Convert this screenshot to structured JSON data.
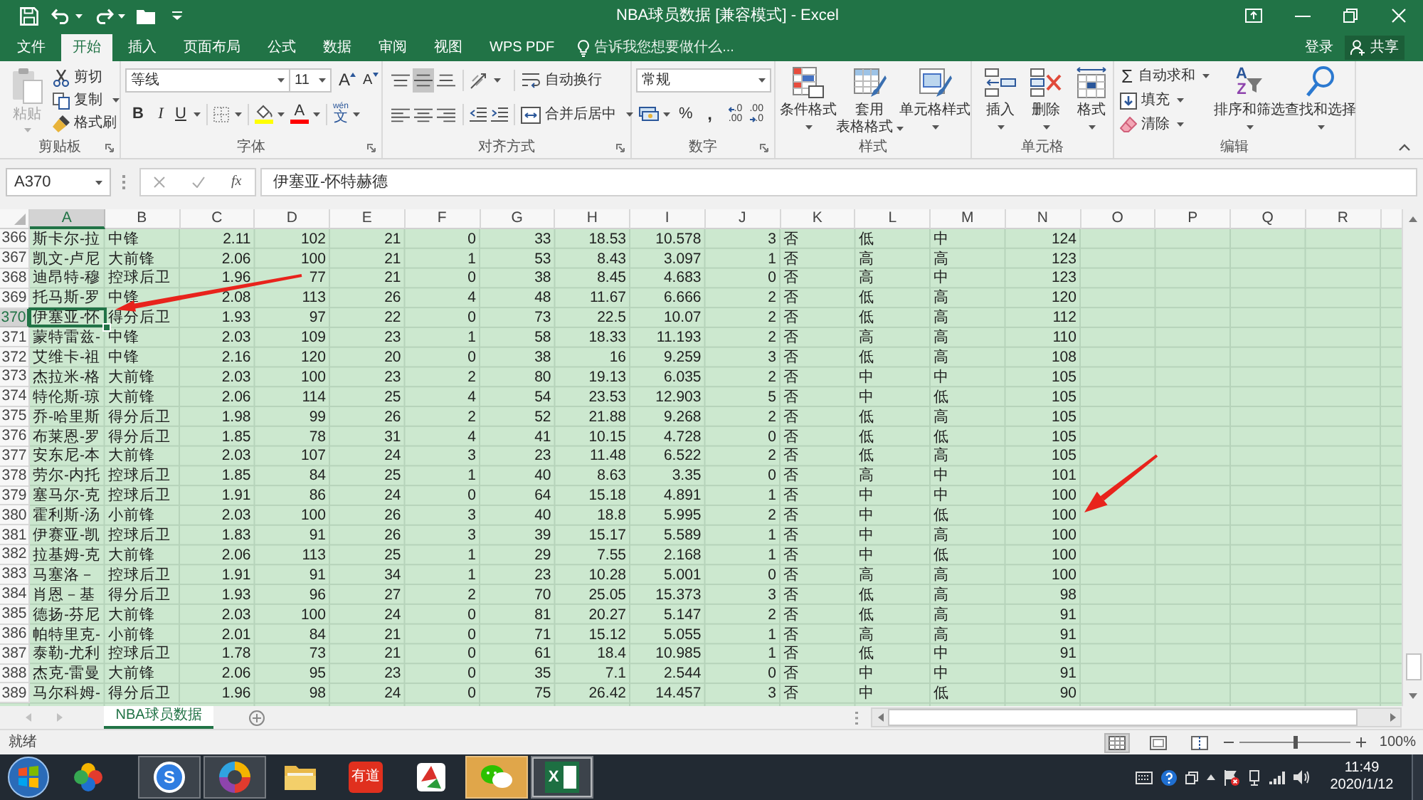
{
  "title_bar": {
    "title": "NBA球员数据 [兼容模式] - Excel"
  },
  "ribbon_tabs": [
    {
      "label": "文件",
      "selected": false
    },
    {
      "label": "开始",
      "selected": true
    },
    {
      "label": "插入",
      "selected": false
    },
    {
      "label": "页面布局",
      "selected": false
    },
    {
      "label": "公式",
      "selected": false
    },
    {
      "label": "数据",
      "selected": false
    },
    {
      "label": "审阅",
      "selected": false
    },
    {
      "label": "视图",
      "selected": false
    },
    {
      "label": "WPS PDF",
      "selected": false
    }
  ],
  "tell_me": {
    "placeholder": "告诉我您想要做什么..."
  },
  "account": {
    "sign_in": "登录",
    "share": "共享"
  },
  "ribbon": {
    "clipboard": {
      "label": "剪贴板",
      "paste": {
        "label": "粘贴",
        "disabled": true
      },
      "buttons": [
        {
          "kind": "cut",
          "label": "剪切"
        },
        {
          "kind": "copy",
          "label": "复制"
        },
        {
          "kind": "format_painter",
          "label": "格式刷"
        }
      ]
    },
    "font": {
      "label": "字体",
      "font_name": "等线",
      "font_size": "11",
      "grow": "A",
      "shrink": "A",
      "bold": "B",
      "italic": "I",
      "underline": "U",
      "font_color": "A",
      "phonetic": {
        "top": "wén",
        "bottom": "文"
      }
    },
    "alignment": {
      "label": "对齐方式",
      "vertical": [
        {
          "kind": "top",
          "selected": false
        },
        {
          "kind": "middle",
          "selected": true
        },
        {
          "kind": "bottom",
          "selected": false
        }
      ],
      "horizontal": [
        {
          "kind": "left",
          "selected": false
        },
        {
          "kind": "center",
          "selected": false
        },
        {
          "kind": "right",
          "selected": false
        }
      ],
      "wrap_text": "自动换行",
      "merge_center": "合并后居中"
    },
    "number": {
      "label": "数字",
      "format": "常规",
      "percent": "%",
      "comma": ",",
      "decimals": [
        {
          "kind": "increase",
          "top": ".0",
          "bottom": ".00"
        },
        {
          "kind": "decrease",
          "top": ".00",
          "bottom": ".0"
        }
      ]
    },
    "styles": {
      "label": "样式",
      "buttons": [
        {
          "kind": "conditional",
          "lines": [
            "条件格式"
          ]
        },
        {
          "kind": "table",
          "lines": [
            "套用",
            "表格格式"
          ]
        },
        {
          "kind": "cell",
          "lines": [
            "单元格样式"
          ]
        }
      ]
    },
    "cells": {
      "label": "单元格",
      "buttons": [
        {
          "kind": "insert",
          "label": "插入"
        },
        {
          "kind": "delete",
          "label": "删除"
        },
        {
          "kind": "format",
          "label": "格式"
        }
      ]
    },
    "editing": {
      "label": "编辑",
      "small": [
        {
          "kind": "autosum",
          "glyph": "Σ",
          "label": "自动求和"
        },
        {
          "kind": "fill",
          "label": "填充"
        },
        {
          "kind": "clear",
          "label": "清除"
        }
      ],
      "large": [
        {
          "kind": "sort",
          "glyphs": [
            "A",
            "Z"
          ],
          "label": "排序和筛选"
        },
        {
          "kind": "find",
          "label": "查找和选择"
        }
      ]
    }
  },
  "formula_bar": {
    "name_box": "A370",
    "function_button": "fx",
    "formula": "伊塞亚-怀特赫德"
  },
  "sheet": {
    "columns": [
      {
        "label": "A",
        "selected": true
      },
      {
        "label": "B",
        "selected": false
      },
      {
        "label": "C",
        "selected": false
      },
      {
        "label": "D",
        "selected": false
      },
      {
        "label": "E",
        "selected": false
      },
      {
        "label": "F",
        "selected": false
      },
      {
        "label": "G",
        "selected": false
      },
      {
        "label": "H",
        "selected": false
      },
      {
        "label": "I",
        "selected": false
      },
      {
        "label": "J",
        "selected": false
      },
      {
        "label": "K",
        "selected": false
      },
      {
        "label": "L",
        "selected": false
      },
      {
        "label": "M",
        "selected": false
      },
      {
        "label": "N",
        "selected": false
      },
      {
        "label": "O",
        "selected": false
      },
      {
        "label": "P",
        "selected": false
      },
      {
        "label": "Q",
        "selected": false
      },
      {
        "label": "R",
        "selected": false
      }
    ],
    "rows": [
      {
        "number": "366",
        "selected": false,
        "cells": [
          "斯卡尔-拉",
          "中锋",
          "2.11",
          "102",
          "21",
          "0",
          "33",
          "18.53",
          "10.578",
          "3",
          "否",
          "低",
          "中",
          "124"
        ]
      },
      {
        "number": "367",
        "selected": false,
        "cells": [
          "凯文-卢尼",
          "大前锋",
          "2.06",
          "100",
          "21",
          "1",
          "53",
          "8.43",
          "3.097",
          "1",
          "否",
          "高",
          "高",
          "123"
        ]
      },
      {
        "number": "368",
        "selected": false,
        "cells": [
          "迪昂特-穆",
          "控球后卫",
          "1.96",
          "77",
          "21",
          "0",
          "38",
          "8.45",
          "4.683",
          "0",
          "否",
          "高",
          "中",
          "123"
        ]
      },
      {
        "number": "369",
        "selected": false,
        "cells": [
          "托马斯-罗",
          "中锋",
          "2.08",
          "113",
          "26",
          "4",
          "48",
          "11.67",
          "6.666",
          "2",
          "否",
          "低",
          "高",
          "120"
        ]
      },
      {
        "number": "370",
        "selected": true,
        "cells": [
          "伊塞亚-怀",
          "得分后卫",
          "1.93",
          "97",
          "22",
          "0",
          "73",
          "22.5",
          "10.07",
          "2",
          "否",
          "低",
          "高",
          "112"
        ]
      },
      {
        "number": "371",
        "selected": false,
        "cells": [
          "蒙特雷兹-",
          "中锋",
          "2.03",
          "109",
          "23",
          "1",
          "58",
          "18.33",
          "11.193",
          "2",
          "否",
          "高",
          "高",
          "110"
        ]
      },
      {
        "number": "372",
        "selected": false,
        "cells": [
          "艾维卡-祖",
          "中锋",
          "2.16",
          "120",
          "20",
          "0",
          "38",
          "16",
          "9.259",
          "3",
          "否",
          "低",
          "高",
          "108"
        ]
      },
      {
        "number": "373",
        "selected": false,
        "cells": [
          "杰拉米-格",
          "大前锋",
          "2.03",
          "100",
          "23",
          "2",
          "80",
          "19.13",
          "6.035",
          "2",
          "否",
          "中",
          "中",
          "105"
        ]
      },
      {
        "number": "374",
        "selected": false,
        "cells": [
          "特伦斯-琼",
          "大前锋",
          "2.06",
          "114",
          "25",
          "4",
          "54",
          "23.53",
          "12.903",
          "5",
          "否",
          "中",
          "低",
          "105"
        ]
      },
      {
        "number": "375",
        "selected": false,
        "cells": [
          "乔-哈里斯",
          "得分后卫",
          "1.98",
          "99",
          "26",
          "2",
          "52",
          "21.88",
          "9.268",
          "2",
          "否",
          "低",
          "高",
          "105"
        ]
      },
      {
        "number": "376",
        "selected": false,
        "cells": [
          "布莱恩-罗",
          "得分后卫",
          "1.85",
          "78",
          "31",
          "4",
          "41",
          "10.15",
          "4.728",
          "0",
          "否",
          "低",
          "低",
          "105"
        ]
      },
      {
        "number": "377",
        "selected": false,
        "cells": [
          "安东尼-本",
          "大前锋",
          "2.03",
          "107",
          "24",
          "3",
          "23",
          "11.48",
          "6.522",
          "2",
          "否",
          "低",
          "高",
          "105"
        ]
      },
      {
        "number": "378",
        "selected": false,
        "cells": [
          "劳尔-内托",
          "控球后卫",
          "1.85",
          "84",
          "25",
          "1",
          "40",
          "8.63",
          "3.35",
          "0",
          "否",
          "高",
          "中",
          "101"
        ]
      },
      {
        "number": "379",
        "selected": false,
        "cells": [
          "塞马尔-克",
          "控球后卫",
          "1.91",
          "86",
          "24",
          "0",
          "64",
          "15.18",
          "4.891",
          "1",
          "否",
          "中",
          "中",
          "100"
        ]
      },
      {
        "number": "380",
        "selected": false,
        "cells": [
          "霍利斯-汤",
          "小前锋",
          "2.03",
          "100",
          "26",
          "3",
          "40",
          "18.8",
          "5.995",
          "2",
          "否",
          "中",
          "低",
          "100"
        ]
      },
      {
        "number": "381",
        "selected": false,
        "cells": [
          "伊赛亚-凯",
          "控球后卫",
          "1.83",
          "91",
          "26",
          "3",
          "39",
          "15.17",
          "5.589",
          "1",
          "否",
          "中",
          "高",
          "100"
        ]
      },
      {
        "number": "382",
        "selected": false,
        "cells": [
          "拉基姆-克",
          "大前锋",
          "2.06",
          "113",
          "25",
          "1",
          "29",
          "7.55",
          "2.168",
          "1",
          "否",
          "中",
          "低",
          "100"
        ]
      },
      {
        "number": "383",
        "selected": false,
        "cells": [
          "马塞洛－",
          "控球后卫",
          "1.91",
          "91",
          "34",
          "1",
          "23",
          "10.28",
          "5.001",
          "0",
          "否",
          "高",
          "高",
          "100"
        ]
      },
      {
        "number": "384",
        "selected": false,
        "cells": [
          "肖恩－基",
          "得分后卫",
          "1.93",
          "96",
          "27",
          "2",
          "70",
          "25.05",
          "15.373",
          "3",
          "否",
          "低",
          "高",
          "98"
        ]
      },
      {
        "number": "385",
        "selected": false,
        "cells": [
          "德扬-芬尼",
          "大前锋",
          "2.03",
          "100",
          "24",
          "0",
          "81",
          "20.27",
          "5.147",
          "2",
          "否",
          "低",
          "高",
          "91"
        ]
      },
      {
        "number": "386",
        "selected": false,
        "cells": [
          "帕特里克-",
          "小前锋",
          "2.01",
          "84",
          "21",
          "0",
          "71",
          "15.12",
          "5.055",
          "1",
          "否",
          "高",
          "高",
          "91"
        ]
      },
      {
        "number": "387",
        "selected": false,
        "cells": [
          "泰勒-尤利",
          "控球后卫",
          "1.78",
          "73",
          "21",
          "0",
          "61",
          "18.4",
          "10.985",
          "1",
          "否",
          "低",
          "中",
          "91"
        ]
      },
      {
        "number": "388",
        "selected": false,
        "cells": [
          "杰克-雷曼",
          "大前锋",
          "2.06",
          "95",
          "23",
          "0",
          "35",
          "7.1",
          "2.544",
          "0",
          "否",
          "中",
          "中",
          "91"
        ]
      },
      {
        "number": "389",
        "selected": false,
        "cells": [
          "马尔科姆-",
          "得分后卫",
          "1.96",
          "98",
          "24",
          "0",
          "75",
          "26.42",
          "14.457",
          "3",
          "否",
          "中",
          "低",
          "90"
        ]
      }
    ]
  },
  "sheet_tabs": [
    {
      "label": "NBA球员数据",
      "selected": true
    }
  ],
  "status_bar": {
    "status": "就绪",
    "views": [
      {
        "kind": "normal",
        "selected": true
      },
      {
        "kind": "page_layout",
        "selected": false
      },
      {
        "kind": "page_break",
        "selected": false
      }
    ],
    "zoom_slider": {
      "level": 0.5
    },
    "zoom": "100%"
  },
  "annotations": [
    {
      "kind": "arrow"
    },
    {
      "kind": "arrow"
    }
  ],
  "taskbar": {
    "apps": [
      {
        "kind": "pinwheel",
        "open": false,
        "flashing": false,
        "selected": false
      },
      {
        "kind": "letter_circle",
        "glyph": "S",
        "open": true,
        "flashing": false,
        "selected": false
      },
      {
        "kind": "color_ring",
        "open": true,
        "flashing": false,
        "selected": false
      },
      {
        "kind": "folder",
        "open": false,
        "flashing": false,
        "selected": false
      },
      {
        "kind": "letter_tile",
        "glyph": "有道",
        "open": false,
        "flashing": false,
        "selected": false
      },
      {
        "kind": "kite",
        "open": false,
        "flashing": false,
        "selected": false
      },
      {
        "kind": "chat",
        "open": true,
        "flashing": true,
        "selected": false
      },
      {
        "kind": "sheet_tile",
        "glyph": "X",
        "open": true,
        "flashing": false,
        "selected": true
      }
    ],
    "time": "11:49",
    "date": "2020/1/12"
  }
}
